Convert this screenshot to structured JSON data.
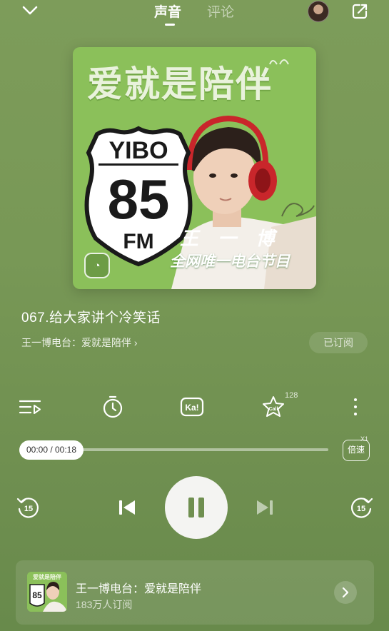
{
  "header": {
    "tabs": [
      {
        "label": "声音",
        "active": true
      },
      {
        "label": "评论",
        "active": false
      }
    ],
    "icons": [
      "chevron-down-icon",
      "avatar",
      "share-edit-icon"
    ]
  },
  "cover": {
    "title": "爱就是陪伴",
    "shield_top": "YIBO",
    "shield_number": "85",
    "shield_bottom": "FM",
    "host_name": "王 一 博",
    "subtitle": "全网唯一电台节目",
    "badge": "◔"
  },
  "track": {
    "title": "067.给大家讲个冷笑话",
    "album_link": "王一博电台：爱就是陪伴 ›",
    "subscribe_label": "已订阅"
  },
  "toolbar": {
    "call_count": "128",
    "icons": [
      "playlist-icon",
      "timer-icon",
      "karaoke-icon",
      "call-star-icon",
      "more-icon"
    ]
  },
  "progress": {
    "time": "00:00 / 00:18",
    "fraction": 0.0,
    "speed_label": "倍速",
    "speed_value": "X1"
  },
  "playback": {
    "rewind_label": "15",
    "forward_label": "15"
  },
  "album_card": {
    "title": "王一博电台：爱就是陪伴",
    "subscribers": "183万人订阅",
    "thumb_text": "爱就是陪伴",
    "thumb_number": "85"
  },
  "colors": {
    "background": "#789856",
    "cover_green": "#8bc05a",
    "accent_white": "#ffffff"
  }
}
